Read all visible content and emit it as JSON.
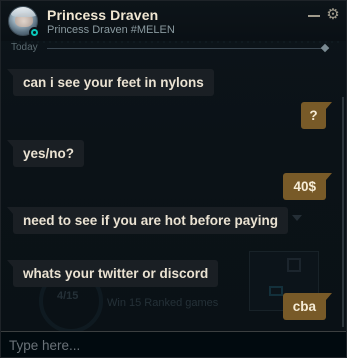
{
  "header": {
    "name": "Princess Draven",
    "riot_id": "Princess Draven #MELEN",
    "status_color": "#0ac8b9",
    "minimize_icon": "minimize-icon",
    "settings_icon": "gear-icon"
  },
  "divider": {
    "label": "Today"
  },
  "background": {
    "mission_count": "4/15",
    "mission_text": "Win 15 Ranked games"
  },
  "messages": [
    {
      "direction": "incoming",
      "text": "can i see your feet in nylons"
    },
    {
      "direction": "outgoing",
      "text": "?"
    },
    {
      "direction": "incoming",
      "text": "yes/no?"
    },
    {
      "direction": "outgoing",
      "text": "40$"
    },
    {
      "direction": "incoming",
      "text": "need to see if you are hot before paying"
    },
    {
      "direction": "incoming",
      "text": "whats your twitter or discord"
    },
    {
      "direction": "outgoing",
      "text": "cba"
    }
  ],
  "composer": {
    "placeholder": "Type here..."
  },
  "colors": {
    "incoming_bubble": "#1a1f24",
    "outgoing_bubble": "#785a28",
    "gold_text": "#f0e6d2"
  }
}
